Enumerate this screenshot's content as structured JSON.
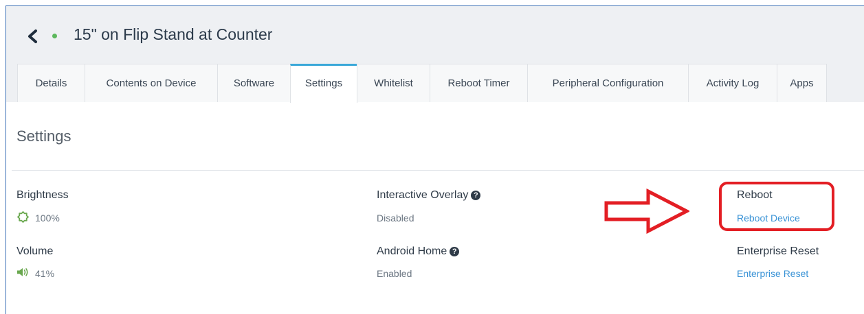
{
  "header": {
    "title": "15\" on Flip Stand at Counter",
    "status_color": "#5cb85c"
  },
  "tabs": [
    {
      "label": "Details",
      "active": false
    },
    {
      "label": "Contents on Device",
      "active": false
    },
    {
      "label": "Software",
      "active": false
    },
    {
      "label": "Settings",
      "active": true
    },
    {
      "label": "Whitelist",
      "active": false
    },
    {
      "label": "Reboot Timer",
      "active": false
    },
    {
      "label": "Peripheral Configuration",
      "active": false
    },
    {
      "label": "Activity Log",
      "active": false
    },
    {
      "label": "Apps",
      "active": false
    }
  ],
  "settings": {
    "title": "Settings",
    "brightness": {
      "label": "Brightness",
      "value": "100%",
      "icon": "brightness-icon"
    },
    "volume": {
      "label": "Volume",
      "value": "41%",
      "icon": "speaker-icon"
    },
    "interactive_overlay": {
      "label": "Interactive Overlay",
      "value": "Disabled"
    },
    "android_home": {
      "label": "Android Home",
      "value": "Enabled"
    },
    "reboot": {
      "label": "Reboot",
      "link": "Reboot Device"
    },
    "enterprise_reset": {
      "label": "Enterprise Reset",
      "link": "Enterprise Reset"
    },
    "help_glyph": "?"
  },
  "colors": {
    "accent": "#3a93d6",
    "active_tab": "#3aa8d8",
    "callout": "#e31e24",
    "icon_green": "#6aa84f"
  }
}
